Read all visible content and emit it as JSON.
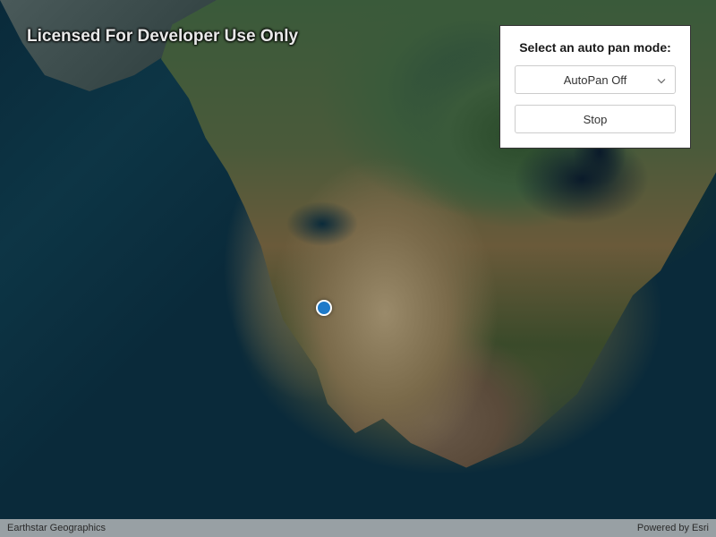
{
  "watermark": "Licensed For Developer Use Only",
  "panel": {
    "title": "Select an auto pan mode:",
    "dropdown_value": "AutoPan Off",
    "stop_label": "Stop"
  },
  "attribution": {
    "left": "Earthstar Geographics",
    "right": "Powered by Esri"
  },
  "marker": {
    "color": "#1e7ac9"
  }
}
